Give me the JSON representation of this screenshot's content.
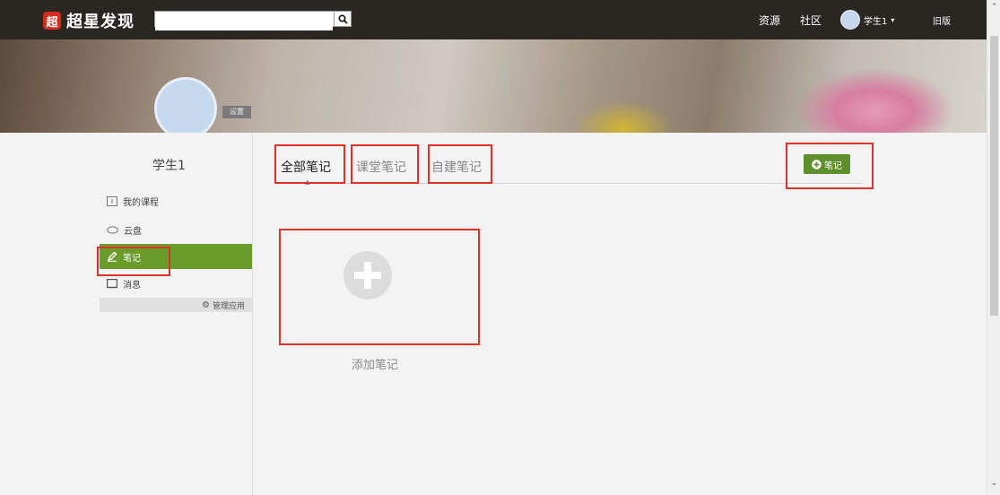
{
  "topbar": {
    "logo_mark": "超",
    "logo_text": "超星发现",
    "search_placeholder": "",
    "nav_resources": "资源",
    "nav_community": "社区",
    "user_name": "学生1",
    "old_version": "旧版"
  },
  "profile": {
    "settings_label": "设置",
    "username": "学生1"
  },
  "sidebar": {
    "items": [
      {
        "label": "我的课程",
        "icon": "course-icon"
      },
      {
        "label": "云盘",
        "icon": "cloud-icon"
      },
      {
        "label": "笔记",
        "icon": "pen-icon"
      },
      {
        "label": "消息",
        "icon": "message-icon"
      }
    ],
    "manage_label": "管理应用"
  },
  "main": {
    "tabs": [
      {
        "label": "全部笔记"
      },
      {
        "label": "课堂笔记"
      },
      {
        "label": "自建笔记"
      }
    ],
    "add_button_label": "笔记",
    "add_note_label": "添加笔记"
  },
  "colors": {
    "accent_green": "#6a9c2b",
    "annotation_red": "#e0302a",
    "topbar": "#2a2622"
  }
}
